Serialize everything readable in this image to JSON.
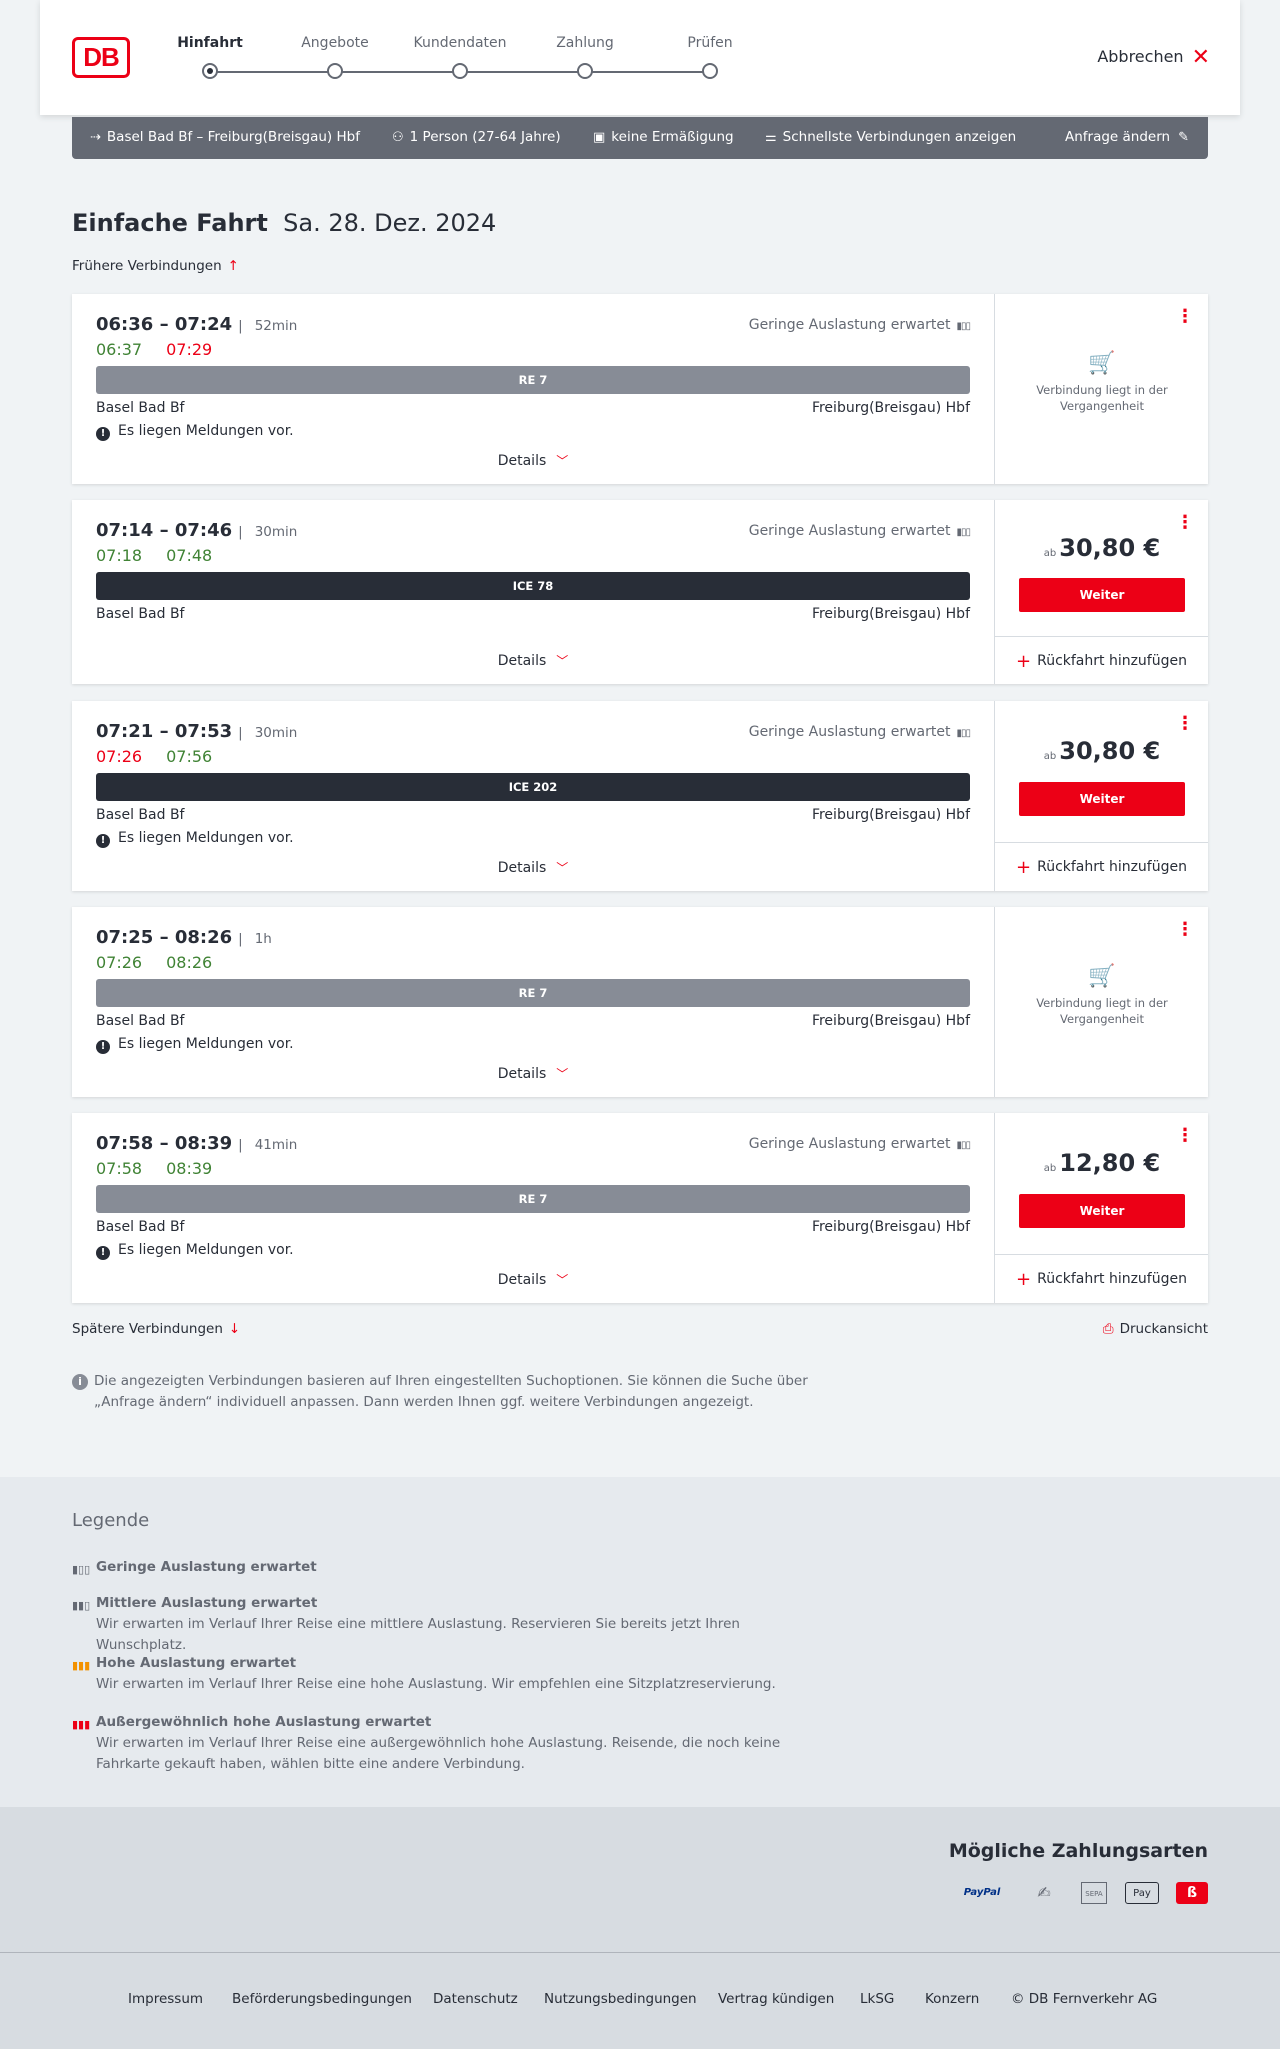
{
  "header": {
    "logo": "DB",
    "steps": [
      {
        "label": "Hinfahrt",
        "active": true
      },
      {
        "label": "Angebote",
        "active": false
      },
      {
        "label": "Kundendaten",
        "active": false
      },
      {
        "label": "Zahlung",
        "active": false
      },
      {
        "label": "Prüfen",
        "active": false
      }
    ],
    "cancel_label": "Abbrechen"
  },
  "summary": {
    "route": "Basel Bad Bf – Freiburg(Breisgau) Hbf",
    "passengers": "1 Person (27-64 Jahre)",
    "discount": "keine Ermäßigung",
    "option": "Schnellste Verbindungen anzeigen",
    "change": "Anfrage ändern"
  },
  "title": {
    "main": "Einfache Fahrt",
    "date": "Sa. 28. Dez. 2024"
  },
  "earlier": "Frühere Verbindungen",
  "later": "Spätere Verbindungen",
  "print": "Druckansicht",
  "connections": [
    {
      "times": "06:36 – 07:24",
      "duration": "52min",
      "rt_dep": "06:37",
      "rt_arr": "07:29",
      "load": "Geringe Auslastung erwartet",
      "train": "RE 7",
      "from": "Basel Bad Bf",
      "to": "Freiburg(Breisgau) Hbf",
      "message": "Es liegen Meldungen vor.",
      "details": "Details",
      "past": "Verbindung liegt in der Vergangenheit"
    },
    {
      "times": "07:14 – 07:46",
      "duration": "30min",
      "rt_dep": "07:18",
      "rt_arr": "07:48",
      "load": "Geringe Auslastung erwartet",
      "train": "ICE 78",
      "from": "Basel Bad Bf",
      "to": "Freiburg(Breisgau) Hbf",
      "details": "Details",
      "price_prefix": "ab",
      "price": "30,80 €",
      "button": "Weiter",
      "return": "Rückfahrt hinzufügen"
    },
    {
      "times": "07:21 – 07:53",
      "duration": "30min",
      "rt_dep": "07:26",
      "rt_arr": "07:56",
      "load": "Geringe Auslastung erwartet",
      "train": "ICE 202",
      "from": "Basel Bad Bf",
      "to": "Freiburg(Breisgau) Hbf",
      "message": "Es liegen Meldungen vor.",
      "details": "Details",
      "price_prefix": "ab",
      "price": "30,80 €",
      "button": "Weiter",
      "return": "Rückfahrt hinzufügen"
    },
    {
      "times": "07:25 – 08:26",
      "duration": "1h",
      "rt_dep": "07:26",
      "rt_arr": "08:26",
      "train": "RE 7",
      "from": "Basel Bad Bf",
      "to": "Freiburg(Breisgau) Hbf",
      "message": "Es liegen Meldungen vor.",
      "details": "Details",
      "past": "Verbindung liegt in der Vergangenheit"
    },
    {
      "times": "07:58 – 08:39",
      "duration": "41min",
      "rt_dep": "07:58",
      "rt_arr": "08:39",
      "load": "Geringe Auslastung erwartet",
      "train": "RE 7",
      "from": "Basel Bad Bf",
      "to": "Freiburg(Breisgau) Hbf",
      "message": "Es liegen Meldungen vor.",
      "details": "Details",
      "price_prefix": "ab",
      "price": "12,80 €",
      "button": "Weiter",
      "return": "Rückfahrt hinzufügen"
    }
  ],
  "info_text": "Die angezeigten Verbindungen basieren auf Ihren eingestellten Suchoptionen. Sie können die Suche über „Anfrage ändern“ individuell anpassen. Dann werden Ihnen ggf. weitere Verbindungen angezeigt.",
  "legend": {
    "title": "Legende",
    "items": [
      {
        "title": "Geringe Auslastung erwartet",
        "text": ""
      },
      {
        "title": "Mittlere Auslastung erwartet",
        "text": "Wir erwarten im Verlauf Ihrer Reise eine mittlere Auslastung. Reservieren Sie bereits jetzt Ihren Wunschplatz."
      },
      {
        "title": "Hohe Auslastung erwartet",
        "text": "Wir erwarten im Verlauf Ihrer Reise eine hohe Auslastung. Wir empfehlen eine Sitzplatzreservierung."
      },
      {
        "title": "Außergewöhnlich hohe Auslastung erwartet",
        "text": "Wir erwarten im Verlauf Ihrer Reise eine außergewöhnlich hohe Auslastung. Reisende, die noch keine Fahrkarte gekauft haben, wählen bitte eine andere Verbindung."
      }
    ]
  },
  "payment": {
    "title": "Mögliche Zahlungsarten",
    "methods": [
      "PayPal",
      "SEPA",
      "Pay"
    ]
  },
  "footer": [
    "Impressum",
    "Beförderungsbedingungen",
    "Datenschutz",
    "Nutzungsbedingungen",
    "Vertrag kündigen",
    "LkSG",
    "Konzern",
    "© DB Fernverkehr AG"
  ],
  "colors": {
    "accent": "#ec0016",
    "on_time": "#408335",
    "dark": "#282d37",
    "gray": "#646973"
  }
}
